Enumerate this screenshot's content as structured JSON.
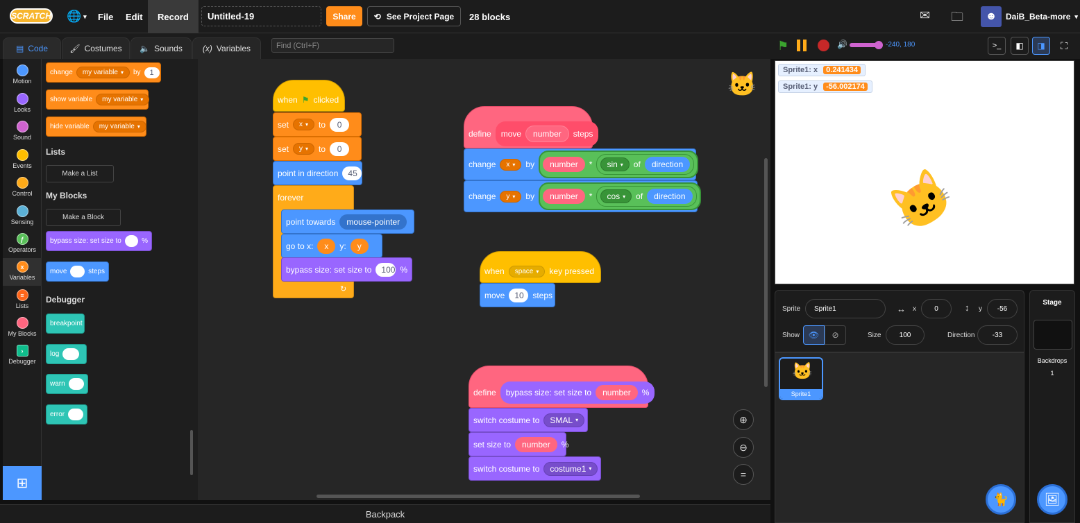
{
  "topbar": {
    "logo": "SCRATCH",
    "file": "File",
    "edit": "Edit",
    "record": "Record",
    "project_title": "Untitled-19",
    "share": "Share",
    "see_project": "See Project Page",
    "blocks_count": "28 blocks",
    "username": "DaiB_Beta-more"
  },
  "tabs": {
    "code": "Code",
    "costumes": "Costumes",
    "sounds": "Sounds",
    "variables": "Variables",
    "find_placeholder": "Find (Ctrl+F)"
  },
  "categories": [
    "Motion",
    "Looks",
    "Sound",
    "Events",
    "Control",
    "Sensing",
    "Operators",
    "Variables",
    "Lists",
    "My Blocks",
    "Debugger"
  ],
  "category_colors": [
    "#4c97ff",
    "#9966ff",
    "#cf63cf",
    "#ffbf00",
    "#ffab19",
    "#5cb1d6",
    "#59c059",
    "#ff8c1a",
    "#ff661a",
    "#ff6680",
    "#0fbd8c"
  ],
  "palette": {
    "change": "change",
    "my_variable": "my variable",
    "by": "by",
    "one": "1",
    "show_variable": "show variable",
    "hide_variable": "hide variable",
    "lists_head": "Lists",
    "make_list": "Make a List",
    "myblocks_head": "My Blocks",
    "make_block": "Make a Block",
    "bypass": "bypass size: set size to",
    "percent": "%",
    "move": "move",
    "steps": "steps",
    "debugger_head": "Debugger",
    "breakpoint": "breakpoint",
    "log": "log",
    "warn": "warn",
    "error": "error"
  },
  "script1": {
    "when": "when",
    "clicked": "clicked",
    "set": "set",
    "x": "x",
    "y": "y",
    "to": "to",
    "zero": "0",
    "point_dir": "point in direction",
    "dir_val": "45",
    "forever": "forever",
    "point_towards": "point towards",
    "mouse": "mouse-pointer",
    "goto": "go to x:",
    "ylbl": "y:",
    "bypass": "bypass size: set size to",
    "hundred": "100",
    "percent": "%"
  },
  "script2": {
    "define": "define",
    "move": "move",
    "number": "number",
    "steps": "steps",
    "change": "change",
    "x": "x",
    "y": "y",
    "by": "by",
    "times": "*",
    "sin": "sin",
    "cos": "cos",
    "of": "of",
    "direction": "direction"
  },
  "script3": {
    "when": "when",
    "space": "space",
    "key_pressed": "key pressed",
    "move": "move",
    "ten": "10",
    "steps": "steps"
  },
  "script4": {
    "define": "define",
    "bypass": "bypass size: set size to",
    "number": "number",
    "percent": "%",
    "switch": "switch costume to",
    "smal": "SMAL",
    "set_size": "set size to",
    "costume1": "costume1"
  },
  "backpack": "Backpack",
  "stage": {
    "coords": "-240, 180",
    "mon_x_label": "Sprite1: x",
    "mon_x_val": "0.241434",
    "mon_y_label": "Sprite1: y",
    "mon_y_val": "-56.002174"
  },
  "sprite_info": {
    "sprite_label": "Sprite",
    "sprite_name": "Sprite1",
    "x_label": "x",
    "x_val": "0",
    "y_label": "y",
    "y_val": "-56",
    "show_label": "Show",
    "size_label": "Size",
    "size_val": "100",
    "direction_label": "Direction",
    "direction_val": "-33"
  },
  "sprites": [
    {
      "name": "Sprite1"
    }
  ],
  "stage_panel": {
    "title": "Stage",
    "backdrops": "Backdrops",
    "count": "1"
  }
}
